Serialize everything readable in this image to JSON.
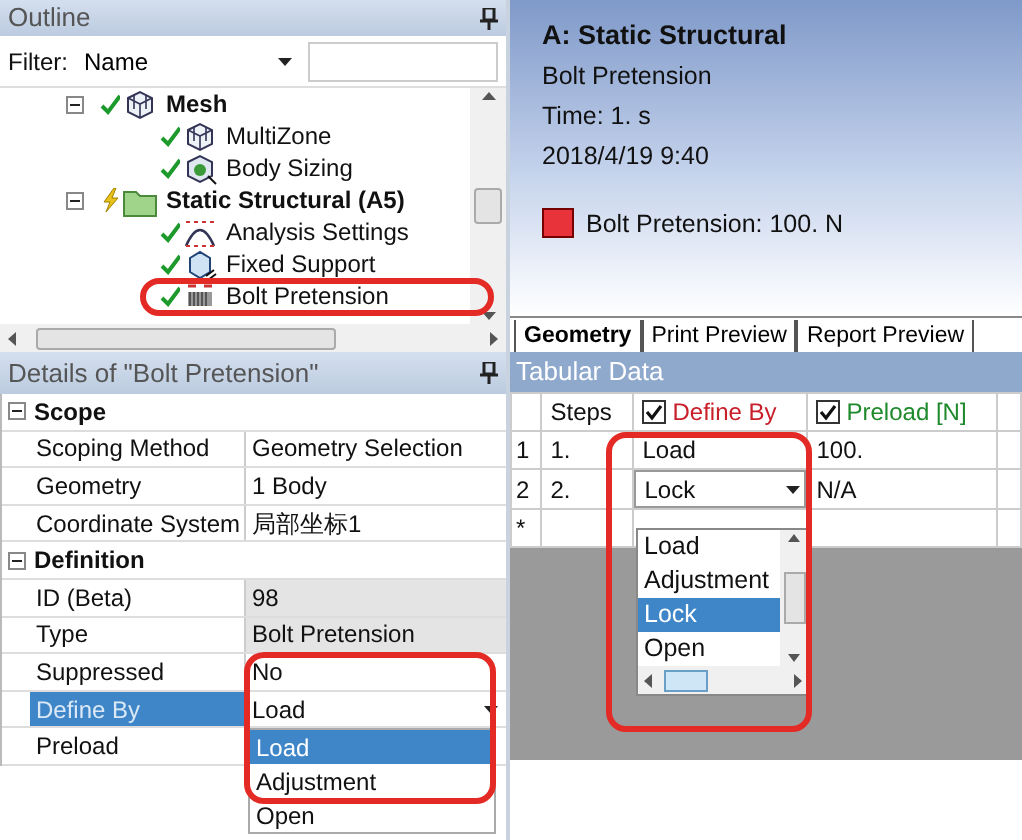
{
  "outline": {
    "title": "Outline",
    "filter_label": "Filter:",
    "filter_value": "Name",
    "tree": [
      {
        "label": "Mesh",
        "kind": "mesh",
        "solved": true,
        "expanded": true,
        "children": [
          {
            "label": "MultiZone",
            "kind": "mesh",
            "solved": true
          },
          {
            "label": "Body Sizing",
            "kind": "sizing",
            "solved": true
          }
        ]
      },
      {
        "label": "Static Structural (A5)",
        "kind": "folder",
        "solved": false,
        "expanded": true,
        "children": [
          {
            "label": "Analysis Settings",
            "kind": "settings",
            "solved": true
          },
          {
            "label": "Fixed Support",
            "kind": "support",
            "solved": true
          },
          {
            "label": "Bolt Pretension",
            "kind": "bolt",
            "solved": true
          }
        ]
      }
    ]
  },
  "viewer": {
    "title": "A: Static Structural",
    "lines": [
      "Bolt Pretension",
      "Time: 1. s",
      "2018/4/19 9:40"
    ],
    "legend": {
      "label": "Bolt Pretension: 100. N",
      "color": "#e8333a"
    },
    "tabs": [
      {
        "label": "Geometry",
        "selected": true
      },
      {
        "label": "Print Preview",
        "selected": false
      },
      {
        "label": "Report Preview",
        "selected": false
      }
    ]
  },
  "details": {
    "title": "Details of \"Bolt Pretension\"",
    "rows": [
      {
        "kind": "group",
        "label": "Scope",
        "expanded": true
      },
      {
        "kind": "property",
        "name": "Scoping Method",
        "value": "Geometry Selection",
        "readonly": false,
        "selected": false
      },
      {
        "kind": "property",
        "name": "Geometry",
        "value": "1 Body",
        "readonly": false,
        "selected": false
      },
      {
        "kind": "property",
        "name": "Coordinate System",
        "value": "局部坐标1",
        "readonly": false,
        "selected": false
      },
      {
        "kind": "group",
        "label": "Definition",
        "expanded": true
      },
      {
        "kind": "property",
        "name": "ID (Beta)",
        "value": "98",
        "readonly": true,
        "selected": false
      },
      {
        "kind": "property",
        "name": "Type",
        "value": "Bolt Pretension",
        "readonly": true,
        "selected": false
      },
      {
        "kind": "property",
        "name": "Suppressed",
        "value": "No",
        "readonly": false,
        "selected": false
      },
      {
        "kind": "property",
        "name": "Define By",
        "value": "Load",
        "readonly": false,
        "selected": true,
        "options": [
          {
            "label": "Load",
            "selected": true
          },
          {
            "label": "Adjustment",
            "selected": false
          },
          {
            "label": "Open",
            "selected": false
          }
        ]
      },
      {
        "kind": "property",
        "name": "Preload",
        "readonly": false,
        "selected": false
      }
    ]
  },
  "tabular": {
    "title": "Tabular Data",
    "columns": [
      {
        "label": "Steps"
      },
      {
        "label": "Define By",
        "checked": true,
        "color": "#c8202a"
      },
      {
        "label": "Preload [N]",
        "checked": true,
        "color": "#1f8a2c"
      }
    ],
    "rows": [
      {
        "index": "1",
        "cells": [
          {
            "text": "1."
          },
          {
            "text": "Load"
          },
          {
            "text": "100."
          }
        ]
      },
      {
        "index": "2",
        "cells": [
          {
            "text": "2."
          },
          {
            "text": "Lock",
            "kind": "combo",
            "options": [
              {
                "label": "Load",
                "selected": false
              },
              {
                "label": "Adjustment",
                "selected": false
              },
              {
                "label": "Lock",
                "selected": true
              },
              {
                "label": "Open",
                "selected": false
              }
            ]
          },
          {
            "text": "N/A"
          }
        ]
      },
      {
        "index": "*"
      }
    ]
  }
}
